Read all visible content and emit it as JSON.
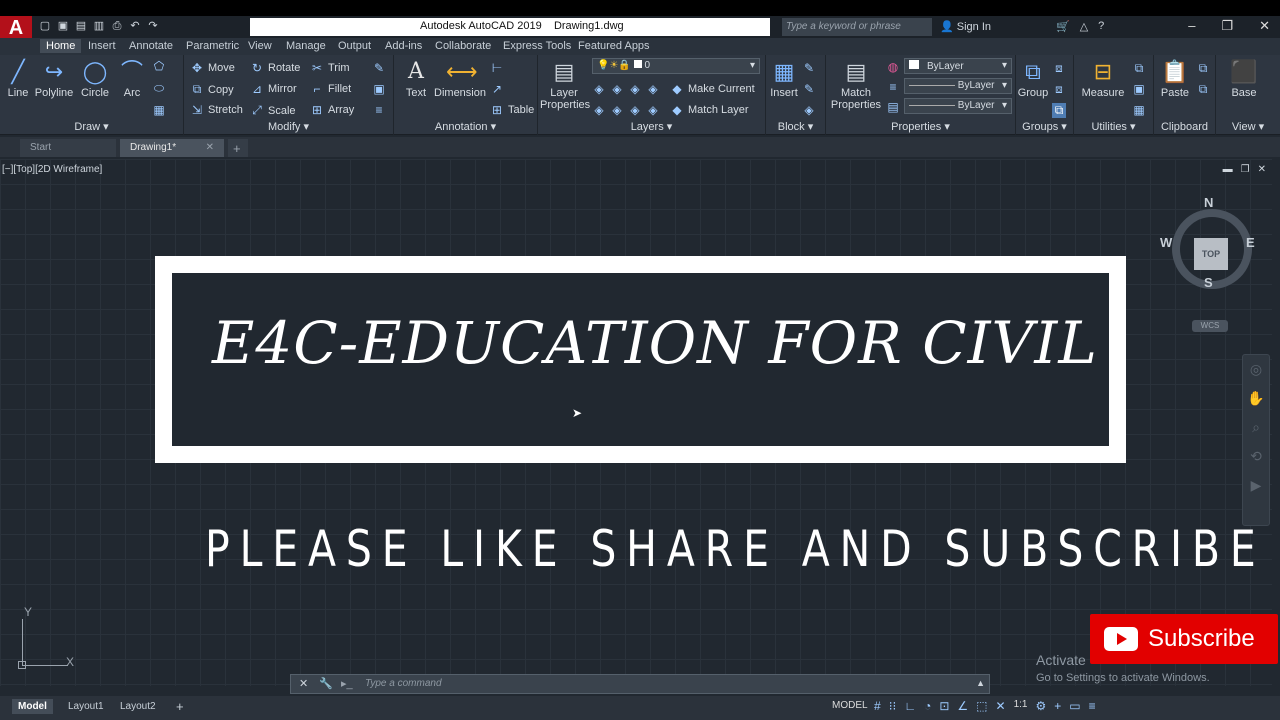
{
  "titlebar": {
    "app_title": "Autodesk AutoCAD 2019",
    "file_name": "Drawing1.dwg",
    "search_placeholder": "Type a keyword or phrase",
    "sign_in": "Sign In"
  },
  "ribbon_tabs": [
    "Home",
    "Insert",
    "Annotate",
    "Parametric",
    "View",
    "Manage",
    "Output",
    "Add-ins",
    "Collaborate",
    "Express Tools",
    "Featured Apps"
  ],
  "panels": {
    "draw": {
      "label": "Draw",
      "tools": [
        "Line",
        "Polyline",
        "Circle",
        "Arc"
      ]
    },
    "modify": {
      "label": "Modify",
      "rows": [
        [
          "Move",
          "Rotate",
          "Trim"
        ],
        [
          "Copy",
          "Mirror",
          "Fillet"
        ],
        [
          "Stretch",
          "Scale",
          "Array"
        ]
      ]
    },
    "annotation": {
      "label": "Annotation",
      "tools": [
        "Text",
        "Dimension",
        "Table"
      ]
    },
    "layers": {
      "label": "Layers",
      "big": "Layer Properties",
      "layer_value": "0",
      "make_current": "Make Current",
      "match_layer": "Match Layer"
    },
    "block": {
      "label": "Block",
      "big": "Insert"
    },
    "properties": {
      "label": "Properties",
      "big": "Match Properties",
      "color": "ByLayer",
      "linetype": "ByLayer",
      "lineweight": "ByLayer"
    },
    "groups": {
      "label": "Groups",
      "big": "Group"
    },
    "utilities": {
      "label": "Utilities",
      "big": "Measure"
    },
    "clipboard": {
      "label": "Clipboard",
      "big": "Paste"
    },
    "view": {
      "label": "View",
      "big": "Base"
    }
  },
  "doc_tabs": [
    "Start",
    "Drawing1*"
  ],
  "viewport": {
    "label": "[−][Top][2D Wireframe]",
    "main_title": "E4C-EDUCATION FOR CIVIL",
    "subtitle": "PLEASE LIKE SHARE AND SUBSCRIBE",
    "viewcube": {
      "n": "N",
      "s": "S",
      "e": "E",
      "w": "W",
      "top": "TOP",
      "wcs": "WCS"
    },
    "ucs_x": "X",
    "ucs_y": "Y"
  },
  "command": {
    "placeholder": "Type a command"
  },
  "watermark": {
    "line1": "Activate",
    "line2": "Go to Settings to activate Windows."
  },
  "subscribe_button": "Subscribe",
  "layout_tabs": [
    "Model",
    "Layout1",
    "Layout2"
  ],
  "status": {
    "model": "MODEL",
    "scale": "1:1"
  }
}
